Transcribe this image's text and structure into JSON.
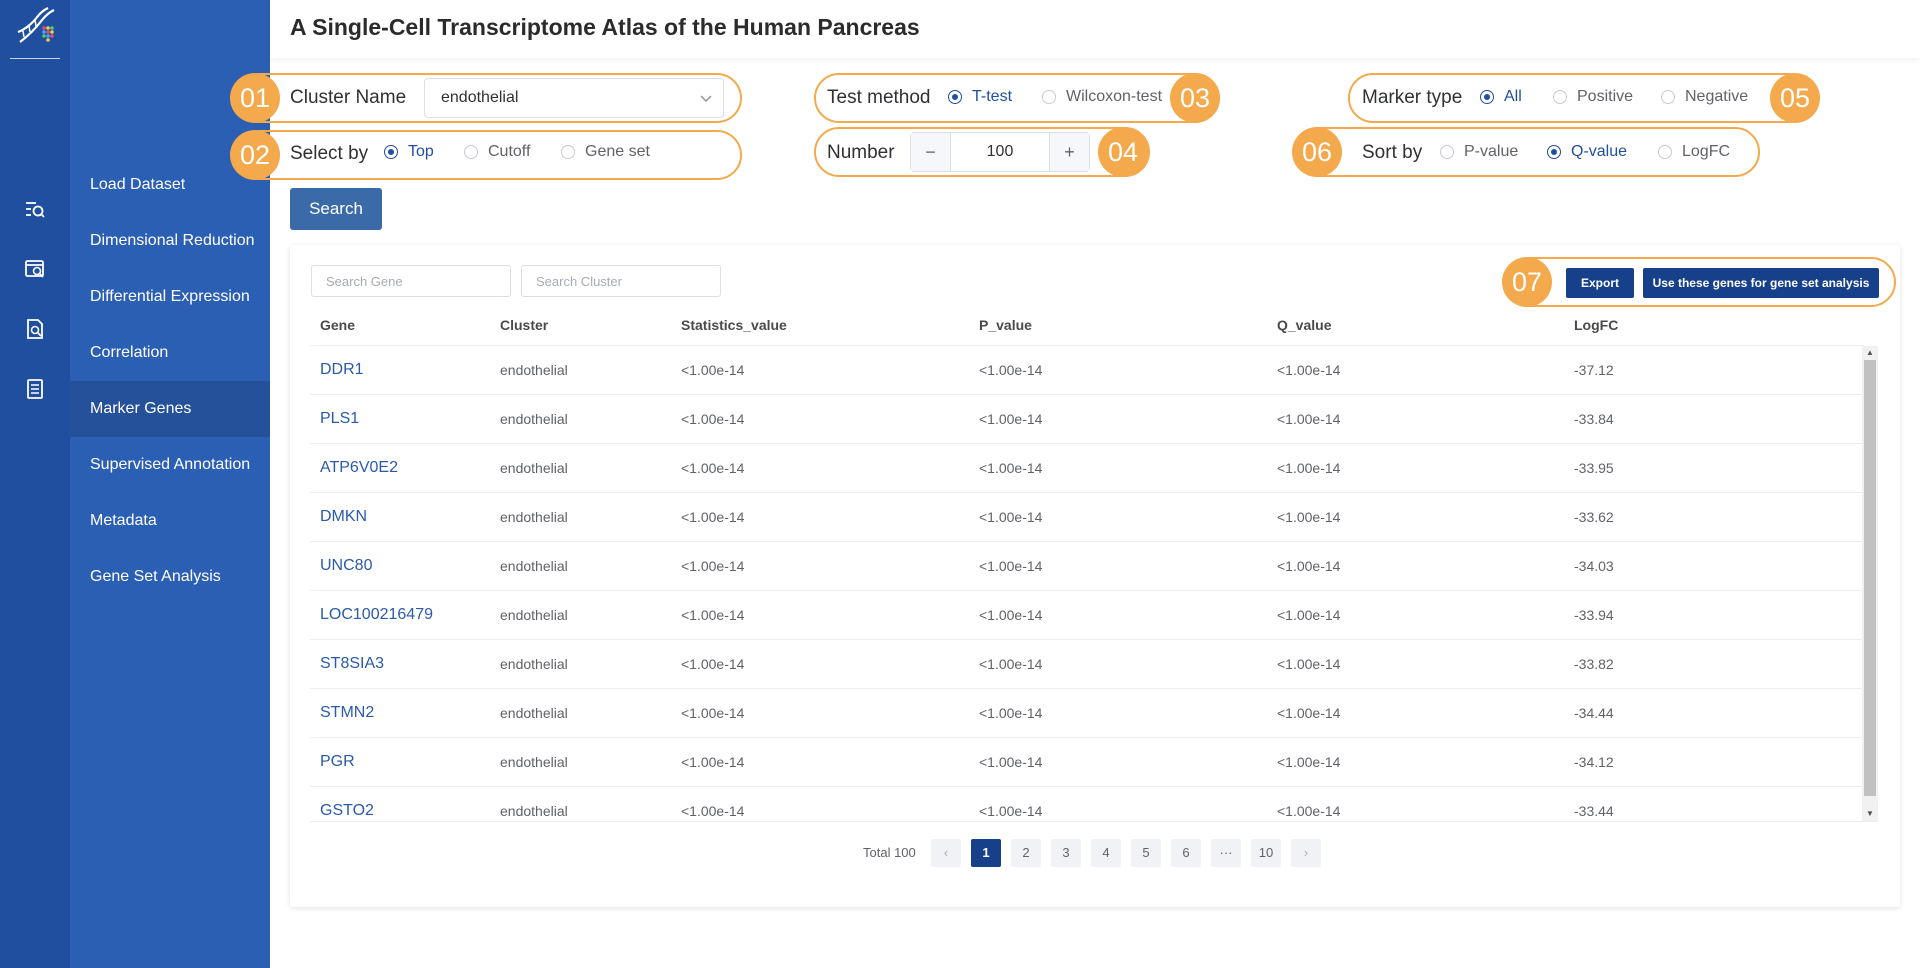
{
  "header": {
    "title": "A Single-Cell Transcriptome Atlas of the Human Pancreas"
  },
  "rail": {
    "icons": [
      "search-list-icon",
      "search-window-icon",
      "search-document-icon",
      "document-list-icon"
    ]
  },
  "nav": {
    "items": [
      {
        "label": "Load Dataset"
      },
      {
        "label": "Dimensional Reduction"
      },
      {
        "label": "Differential Expression"
      },
      {
        "label": "Correlation"
      },
      {
        "label": "Marker Genes",
        "active": true
      },
      {
        "label": "Supervised Annotation"
      },
      {
        "label": "Metadata"
      },
      {
        "label": "Gene Set Analysis"
      }
    ]
  },
  "controls": {
    "cluster": {
      "badge": "01",
      "label": "Cluster Name",
      "value": "endothelial"
    },
    "select_by": {
      "badge": "02",
      "label": "Select by",
      "options": [
        "Top",
        "Cutoff",
        "Gene set"
      ],
      "selected": "Top"
    },
    "test_method": {
      "badge": "03",
      "label": "Test method",
      "options": [
        "T-test",
        "Wilcoxon-test"
      ],
      "selected": "T-test"
    },
    "number": {
      "badge": "04",
      "label": "Number",
      "value": "100",
      "minus": "−",
      "plus": "+"
    },
    "marker_type": {
      "badge": "05",
      "label": "Marker type",
      "options": [
        "All",
        "Positive",
        "Negative"
      ],
      "selected": "All"
    },
    "sort_by": {
      "badge": "06",
      "label": "Sort by",
      "options": [
        "P-value",
        "Q-value",
        "LogFC"
      ],
      "selected": "Q-value"
    },
    "search_label": "Search"
  },
  "table": {
    "badge": "07",
    "gene_placeholder": "Search Gene",
    "cluster_placeholder": "Search Cluster",
    "export_label": "Export",
    "use_genes_label": "Use these genes for gene set analysis",
    "columns": [
      "Gene",
      "Cluster",
      "Statistics_value",
      "P_value",
      "Q_value",
      "LogFC"
    ],
    "rows": [
      [
        "DDR1",
        "endothelial",
        "<1.00e-14",
        "<1.00e-14",
        "<1.00e-14",
        "-37.12"
      ],
      [
        "PLS1",
        "endothelial",
        "<1.00e-14",
        "<1.00e-14",
        "<1.00e-14",
        "-33.84"
      ],
      [
        "ATP6V0E2",
        "endothelial",
        "<1.00e-14",
        "<1.00e-14",
        "<1.00e-14",
        "-33.95"
      ],
      [
        "DMKN",
        "endothelial",
        "<1.00e-14",
        "<1.00e-14",
        "<1.00e-14",
        "-33.62"
      ],
      [
        "UNC80",
        "endothelial",
        "<1.00e-14",
        "<1.00e-14",
        "<1.00e-14",
        "-34.03"
      ],
      [
        "LOC100216479",
        "endothelial",
        "<1.00e-14",
        "<1.00e-14",
        "<1.00e-14",
        "-33.94"
      ],
      [
        "ST8SIA3",
        "endothelial",
        "<1.00e-14",
        "<1.00e-14",
        "<1.00e-14",
        "-33.82"
      ],
      [
        "STMN2",
        "endothelial",
        "<1.00e-14",
        "<1.00e-14",
        "<1.00e-14",
        "-34.44"
      ],
      [
        "PGR",
        "endothelial",
        "<1.00e-14",
        "<1.00e-14",
        "<1.00e-14",
        "-34.12"
      ],
      [
        "GSTO2",
        "endothelial",
        "<1.00e-14",
        "<1.00e-14",
        "<1.00e-14",
        "-33.44"
      ]
    ]
  },
  "pagination": {
    "total_label": "Total 100",
    "prev": "‹",
    "next": "›",
    "pages": [
      "1",
      "2",
      "3",
      "4",
      "5",
      "6",
      "···",
      "10"
    ],
    "current": "1"
  },
  "colors": {
    "rail": "#1f4f9e",
    "nav": "#2b5fb4",
    "accent": "#f4a94c",
    "primary": "#16408a",
    "link": "#2a5aa8"
  }
}
